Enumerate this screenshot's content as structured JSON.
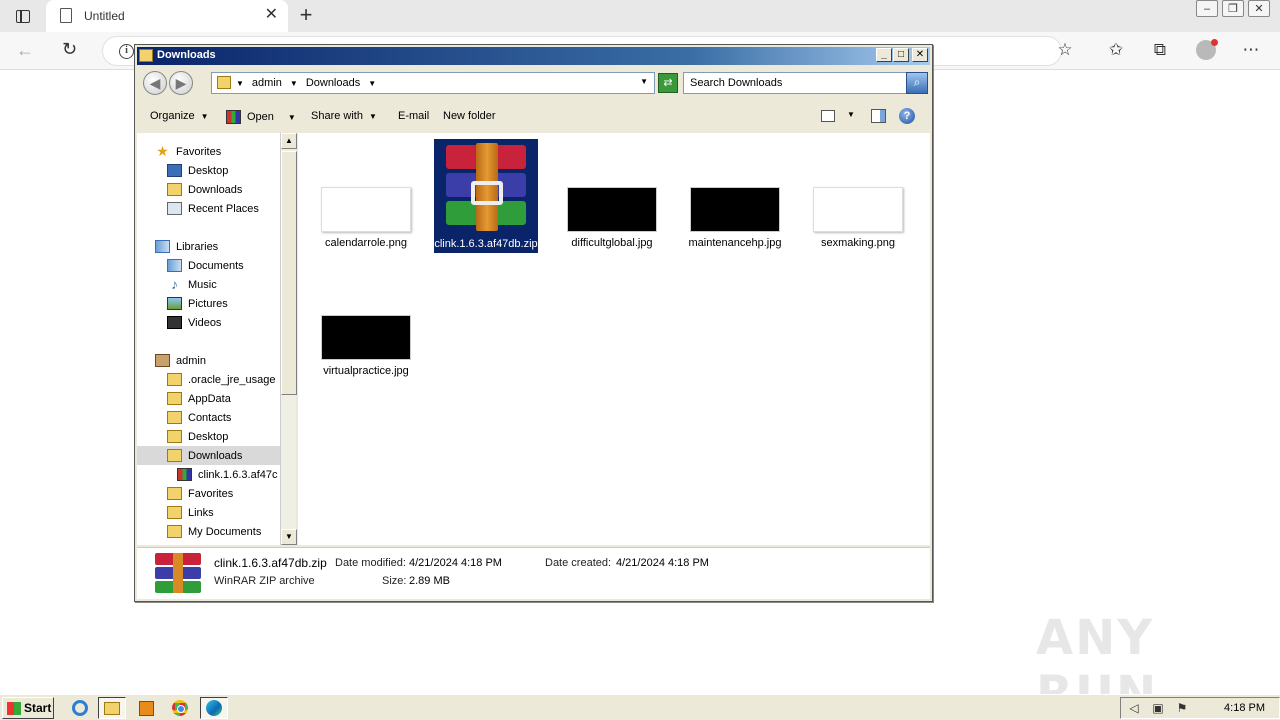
{
  "browser": {
    "tab_title": "Untitled",
    "tab_close": "✕",
    "new_tab": "+",
    "back": "←",
    "refresh": "↻",
    "info": "i",
    "toolbar_icons": [
      "favorite-add-icon",
      "favorites-icon",
      "collections-icon",
      "profile-icon",
      "more-icon"
    ],
    "more": "⋯"
  },
  "explorer": {
    "title": "Downloads",
    "breadcrumb": [
      "admin",
      "Downloads"
    ],
    "search_placeholder": "Search Downloads",
    "commands": {
      "organize": "Organize",
      "open": "Open",
      "share_with": "Share with",
      "email": "E-mail",
      "new_folder": "New folder"
    },
    "nav": {
      "favorites": "Favorites",
      "fav_desktop": "Desktop",
      "fav_downloads": "Downloads",
      "fav_recent": "Recent Places",
      "libraries": "Libraries",
      "lib_documents": "Documents",
      "lib_music": "Music",
      "lib_pictures": "Pictures",
      "lib_videos": "Videos",
      "admin": "admin",
      "oracle": ".oracle_jre_usage",
      "appdata": "AppData",
      "contacts": "Contacts",
      "desktop": "Desktop",
      "downloads": "Downloads",
      "clink": "clink.1.6.3.af47c",
      "favorites2": "Favorites",
      "links": "Links",
      "my_documents": "My Documents"
    },
    "files": [
      {
        "name": "calendarrole.png"
      },
      {
        "name": "clink.1.6.3.af47db.zip"
      },
      {
        "name": "difficultglobal.jpg"
      },
      {
        "name": "maintenancehp.jpg"
      },
      {
        "name": "sexmaking.png"
      },
      {
        "name": "virtualpractice.jpg"
      }
    ],
    "status": {
      "name": "clink.1.6.3.af47db.zip",
      "modified_label": "Date modified:",
      "modified": "4/21/2024 4:18 PM",
      "created_label": "Date created:",
      "created": "4/21/2024 4:18 PM",
      "type": "WinRAR ZIP archive",
      "size_label": "Size:",
      "size": "2.89 MB"
    }
  },
  "taskbar": {
    "start": "Start",
    "time": "4:18 PM"
  },
  "watermark": "ANY RUN"
}
